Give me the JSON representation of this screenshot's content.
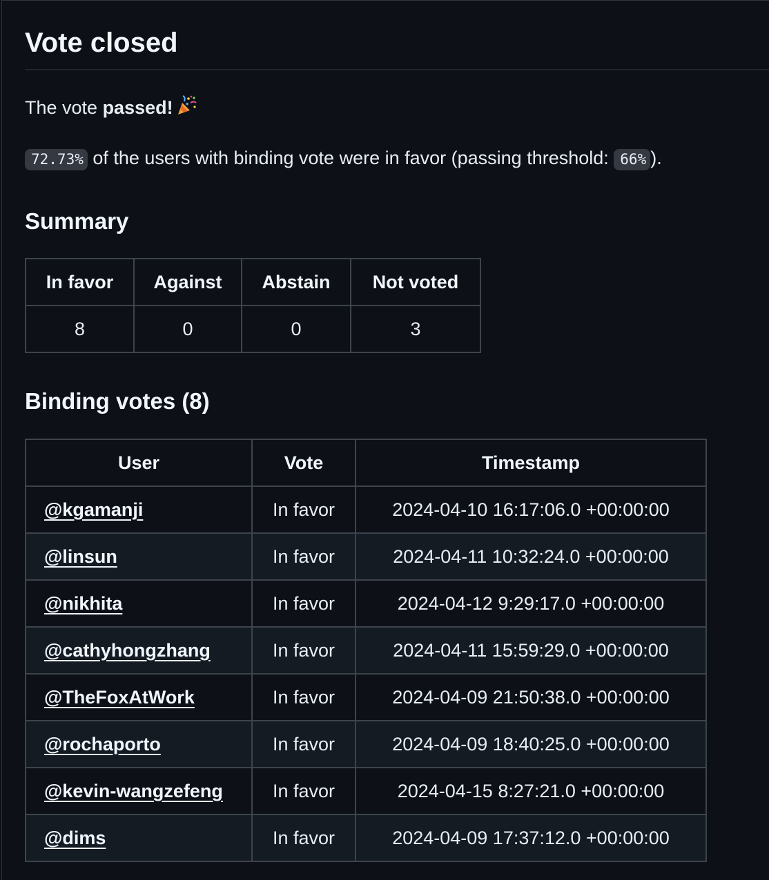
{
  "title": "Vote closed",
  "result": {
    "prefix": "The vote ",
    "status": "passed!",
    "emoji": "party-popper-icon"
  },
  "threshold": {
    "percentage": "72.73%",
    "middle_text": " of the users with binding vote were in favor (passing threshold: ",
    "threshold_value": "66%",
    "suffix": ")."
  },
  "summary": {
    "heading": "Summary",
    "headers": [
      "In favor",
      "Against",
      "Abstain",
      "Not voted"
    ],
    "values": [
      "8",
      "0",
      "0",
      "3"
    ]
  },
  "binding_votes": {
    "heading": "Binding votes (8)",
    "headers": [
      "User",
      "Vote",
      "Timestamp"
    ],
    "rows": [
      {
        "user": "@kgamanji",
        "vote": "In favor",
        "timestamp": "2024-04-10 16:17:06.0 +00:00:00"
      },
      {
        "user": "@linsun",
        "vote": "In favor",
        "timestamp": "2024-04-11 10:32:24.0 +00:00:00"
      },
      {
        "user": "@nikhita",
        "vote": "In favor",
        "timestamp": "2024-04-12 9:29:17.0 +00:00:00"
      },
      {
        "user": "@cathyhongzhang",
        "vote": "In favor",
        "timestamp": "2024-04-11 15:59:29.0 +00:00:00"
      },
      {
        "user": "@TheFoxAtWork",
        "vote": "In favor",
        "timestamp": "2024-04-09 21:50:38.0 +00:00:00"
      },
      {
        "user": "@rochaporto",
        "vote": "In favor",
        "timestamp": "2024-04-09 18:40:25.0 +00:00:00"
      },
      {
        "user": "@kevin-wangzefeng",
        "vote": "In favor",
        "timestamp": "2024-04-15 8:27:21.0 +00:00:00"
      },
      {
        "user": "@dims",
        "vote": "In favor",
        "timestamp": "2024-04-09 17:37:12.0 +00:00:00"
      }
    ]
  }
}
